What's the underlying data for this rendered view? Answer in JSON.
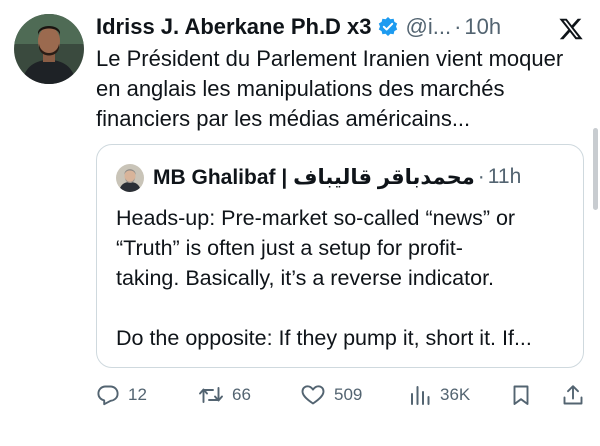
{
  "author": {
    "name": "Idriss J. Aberkane Ph.D x3",
    "handle": "@i...",
    "separator": "·",
    "time": "10h"
  },
  "tweet": {
    "text": "Le Président du Parlement Iranien vient moquer\nen anglais les manipulations des marchés\nfinanciers par les médias américains..."
  },
  "quoted": {
    "name": "MB Ghalibaf | محمدباقر قالیباف",
    "separator": "·",
    "time": "11h",
    "text": "Heads-up: Pre-market so-called “news” or\n“Truth” is often just a setup for profit-\ntaking. Basically, it’s a reverse indicator.\n\nDo the opposite: If they pump it, short it. If..."
  },
  "actions": {
    "replies": "12",
    "reposts": "66",
    "likes": "509",
    "views": "36K"
  },
  "icons": {
    "verified": "verified-badge-icon",
    "logo": "x-logo-icon",
    "reply": "reply-icon",
    "repost": "repost-icon",
    "like": "like-icon",
    "views": "views-icon",
    "bookmark": "bookmark-icon",
    "share": "share-icon"
  },
  "colors": {
    "text": "#0f1419",
    "secondary": "#536471",
    "verified": "#1d9bf0",
    "border": "#cfd9de"
  }
}
